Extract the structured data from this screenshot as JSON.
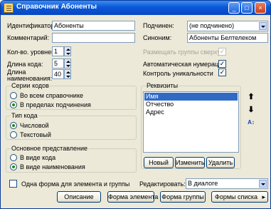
{
  "window": {
    "title": "Справочник Абоненты"
  },
  "fields": {
    "identifier_label": "Идентификатор:",
    "identifier_value": "Абоненты",
    "comment_label": "Комментарий:",
    "comment_value": "",
    "levels_label": "Кол-во. уровней",
    "levels_value": "1",
    "code_length_label": "Длина кода:",
    "code_length_value": "5",
    "name_length_label": "Длина наименования:",
    "name_length_value": "40",
    "subordinate_label": "Подчинен:",
    "subordinate_value": "(не подчинено)",
    "synonym_label": "Синоним:",
    "synonym_value": "Абоненты Белтелеком"
  },
  "options": {
    "groups_top_label": "Размещать группы сверху",
    "groups_top_checked": true,
    "groups_top_enabled": false,
    "auto_numbering_label": "Автоматическая нумерация",
    "auto_numbering_checked": true,
    "unique_control_label": "Контроль уникальности",
    "unique_control_checked": true
  },
  "series_group": {
    "title": "Серии кодов",
    "options": [
      "Во всем справочнике",
      "В пределах подчинения"
    ],
    "selected": 1
  },
  "code_type_group": {
    "title": "Тип кода",
    "options": [
      "Числовой",
      "Текстовый"
    ],
    "selected": 0
  },
  "representation_group": {
    "title": "Основное представление",
    "options": [
      "В виде кода",
      "В виде наименования"
    ],
    "selected": 1
  },
  "requisites": {
    "title": "Реквизиты",
    "items": [
      "Имя",
      "Отчество",
      "Адрес"
    ],
    "selected": 0,
    "new_button": "Новый",
    "change_button": "Изменить",
    "delete_button": "Удалить"
  },
  "footer": {
    "one_form_label": "Одна форма для элемента и группы",
    "one_form_checked": false,
    "edit_label": "Редактировать:",
    "edit_value": "В диалоге",
    "description_button": "Описание",
    "element_form_button": "Форма элемента",
    "group_form_button": "Форма группы",
    "list_forms_button": "Формы списка"
  },
  "icons": {
    "up": "up-arrow-icon",
    "down": "down-arrow-icon",
    "sort": "sort-icon"
  }
}
